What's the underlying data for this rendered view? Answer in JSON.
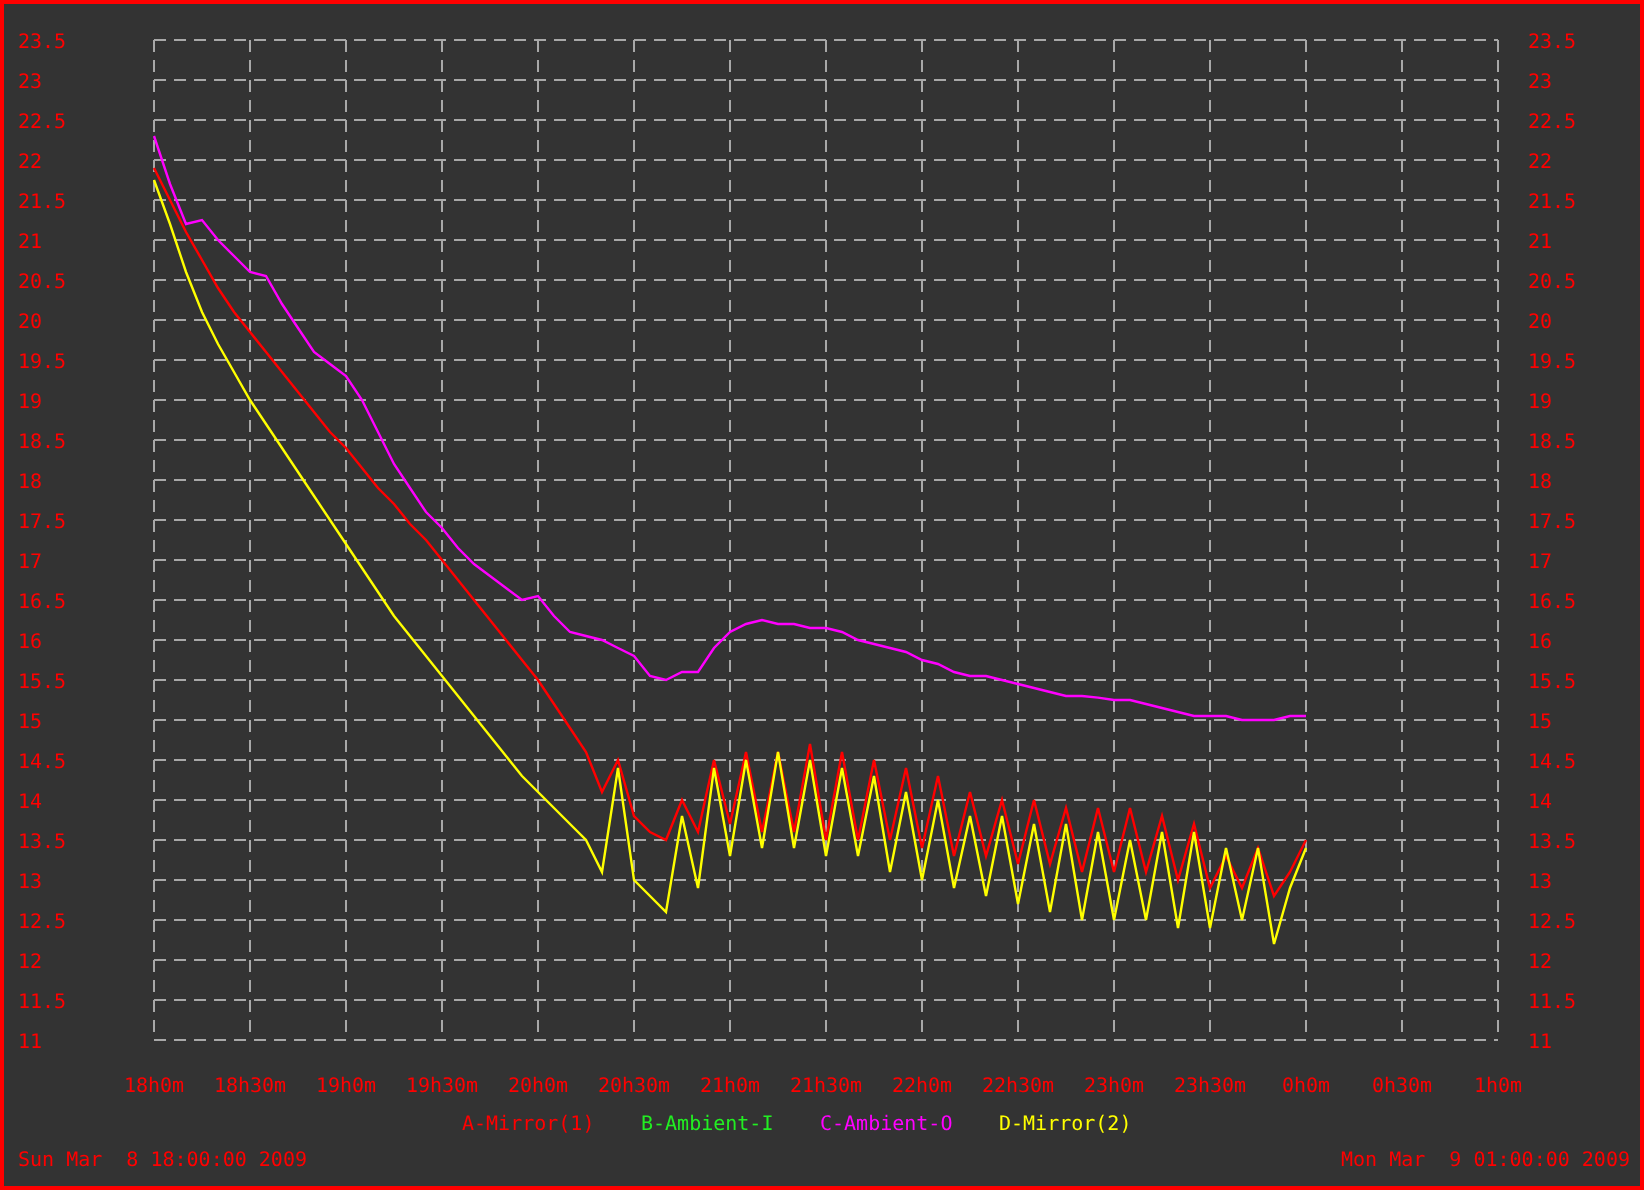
{
  "chart": {
    "chart_data": {
      "type": "line",
      "categories": [
        "18h0m",
        null,
        null,
        null,
        null,
        null,
        "18h30m",
        null,
        null,
        null,
        null,
        null,
        "19h0m",
        null,
        null,
        null,
        null,
        null,
        "19h30m",
        null,
        null,
        null,
        null,
        null,
        "20h0m",
        null,
        null,
        null,
        null,
        null,
        "20h30m",
        null,
        null,
        null,
        null,
        null,
        "21h0m",
        null,
        null,
        null,
        null,
        null,
        "21h30m",
        null,
        null,
        null,
        null,
        null,
        "22h0m",
        null,
        null,
        null,
        null,
        null,
        "22h30m",
        null,
        null,
        null,
        null,
        null,
        "23h0m",
        null,
        null,
        null,
        null,
        null,
        "23h30m",
        null,
        null,
        null,
        null,
        null,
        "0h0m",
        null,
        null,
        null,
        null,
        null,
        "0h30m",
        null,
        null,
        null,
        null,
        null,
        "1h0m"
      ],
      "ylim": [
        11,
        23.5
      ],
      "grid": true,
      "yticks": [
        11,
        11.5,
        12,
        12.5,
        13,
        13.5,
        14,
        14.5,
        15,
        15.5,
        16,
        16.5,
        17,
        17.5,
        18,
        18.5,
        19,
        19.5,
        20,
        20.5,
        21,
        21.5,
        22,
        22.5,
        23,
        23.5
      ],
      "series": [
        {
          "name": "A-Mirror(1)",
          "color": "#ff0000",
          "values": [
            21.9,
            21.5,
            21.1,
            20.75,
            20.4,
            20.1,
            19.85,
            19.6,
            19.35,
            19.1,
            18.85,
            18.6,
            18.4,
            18.15,
            17.9,
            17.7,
            17.45,
            17.25,
            17.0,
            16.75,
            16.5,
            16.25,
            16.0,
            15.75,
            15.5,
            15.2,
            14.9,
            14.6,
            14.1,
            14.5,
            13.8,
            13.6,
            13.5,
            14.0,
            13.6,
            14.5,
            13.7,
            14.6,
            13.6,
            14.6,
            13.6,
            14.7,
            13.5,
            14.6,
            13.5,
            14.5,
            13.5,
            14.4,
            13.4,
            14.3,
            13.3,
            14.1,
            13.3,
            14.0,
            13.2,
            14.0,
            13.2,
            13.9,
            13.1,
            13.9,
            13.1,
            13.9,
            13.1,
            13.8,
            13.0,
            13.7,
            12.9,
            13.3,
            12.9,
            13.4,
            12.8,
            13.1,
            13.5,
            null,
            null,
            null,
            null,
            null,
            null,
            null,
            null,
            null,
            null,
            null,
            null
          ]
        },
        {
          "name": "B-Ambient-I",
          "color": "#22ee22",
          "values": [
            null,
            null,
            null,
            null,
            null,
            null,
            null,
            null,
            null,
            null,
            null,
            null,
            null,
            null,
            null,
            null,
            null,
            null,
            null,
            null,
            null,
            null,
            null,
            null,
            null,
            null,
            null,
            null,
            null,
            null,
            null,
            null,
            null,
            null,
            null,
            null,
            null,
            null,
            null,
            null,
            null,
            null,
            null,
            null,
            null,
            null,
            null,
            null,
            null,
            null,
            null,
            null,
            null,
            null,
            null,
            null,
            null,
            null,
            null,
            null,
            null,
            null,
            null,
            null,
            null,
            null,
            null,
            null,
            null,
            null,
            null,
            null,
            null,
            null,
            null,
            null,
            null,
            null,
            null,
            null,
            null,
            null,
            null,
            null,
            null
          ]
        },
        {
          "name": "C-Ambient-O",
          "color": "#ff00ff",
          "values": [
            22.3,
            21.7,
            21.2,
            21.25,
            21.0,
            20.8,
            20.6,
            20.55,
            20.2,
            19.9,
            19.6,
            19.45,
            19.3,
            19.0,
            18.6,
            18.2,
            17.9,
            17.6,
            17.4,
            17.15,
            16.95,
            16.8,
            16.65,
            16.5,
            16.55,
            16.3,
            16.1,
            16.05,
            16.0,
            15.9,
            15.8,
            15.55,
            15.5,
            15.6,
            15.6,
            15.9,
            16.1,
            16.2,
            16.25,
            16.2,
            16.2,
            16.15,
            16.15,
            16.1,
            16.0,
            15.95,
            15.9,
            15.85,
            15.75,
            15.7,
            15.6,
            15.55,
            15.55,
            15.5,
            15.45,
            15.4,
            15.35,
            15.3,
            15.3,
            15.28,
            15.25,
            15.25,
            15.2,
            15.15,
            15.1,
            15.05,
            15.05,
            15.05,
            15.0,
            15.0,
            15.0,
            15.05,
            15.05,
            null,
            null,
            null,
            null,
            null,
            null,
            null,
            null,
            null,
            null,
            null,
            null
          ]
        },
        {
          "name": "D-Mirror(2)",
          "color": "#ffff00",
          "values": [
            21.75,
            21.2,
            20.6,
            20.1,
            19.7,
            19.35,
            19.0,
            18.7,
            18.4,
            18.1,
            17.8,
            17.5,
            17.2,
            16.9,
            16.6,
            16.3,
            16.05,
            15.8,
            15.55,
            15.3,
            15.05,
            14.8,
            14.55,
            14.3,
            14.1,
            13.9,
            13.7,
            13.5,
            13.1,
            14.4,
            13.0,
            12.8,
            12.6,
            13.8,
            12.9,
            14.4,
            13.3,
            14.5,
            13.4,
            14.6,
            13.4,
            14.5,
            13.3,
            14.4,
            13.3,
            14.3,
            13.1,
            14.1,
            13.0,
            14.0,
            12.9,
            13.8,
            12.8,
            13.8,
            12.7,
            13.7,
            12.6,
            13.7,
            12.5,
            13.6,
            12.5,
            13.5,
            12.5,
            13.6,
            12.4,
            13.6,
            12.4,
            13.4,
            12.5,
            13.4,
            12.2,
            12.9,
            13.4,
            null,
            null,
            null,
            null,
            null,
            null,
            null,
            null,
            null,
            null,
            null,
            null
          ]
        }
      ]
    }
  },
  "left_axis_labels": [
    "23.5",
    "23",
    "22.5",
    "22",
    "21.5",
    "21",
    "20.5",
    "20",
    "19.5",
    "19",
    "18.5",
    "18",
    "17.5",
    "17",
    "16.5",
    "16",
    "15.5",
    "15",
    "14.5",
    "14",
    "13.5",
    "13",
    "12.5",
    "12",
    "11.5",
    "11"
  ],
  "right_axis_labels": [
    "23.5",
    "23",
    "22.5",
    "22",
    "21.5",
    "21",
    "20.5",
    "20",
    "19.5",
    "19",
    "18.5",
    "18",
    "17.5",
    "17",
    "16.5",
    "16",
    "15.5",
    "15",
    "14.5",
    "14",
    "13.5",
    "13",
    "12.5",
    "12",
    "11.5",
    "11"
  ],
  "start_time": "Sun Mar  8 18:00:00 2009",
  "end_time": "Mon Mar  9 01:00:00 2009"
}
